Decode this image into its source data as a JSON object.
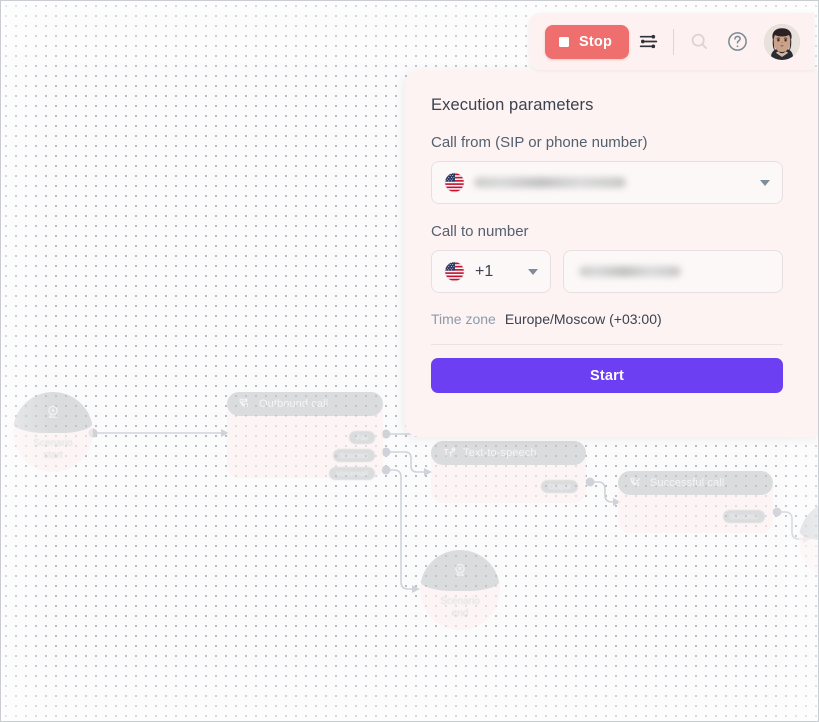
{
  "toolbar": {
    "stop_label": "Stop",
    "stop_icon": "stop-square-icon",
    "settings_icon": "sliders-icon",
    "search_icon": "search-icon",
    "help_icon": "question-circle-icon",
    "avatar_icon": "user-avatar",
    "accent_stop_color": "#ef6f6f"
  },
  "panel": {
    "title": "Execution parameters",
    "call_from": {
      "label": "Call from (SIP or phone number)",
      "flag_icon": "flag-us-icon",
      "value": "",
      "value_redacted": true,
      "caret_icon": "chevron-down-icon"
    },
    "call_to": {
      "label": "Call to number",
      "flag_icon": "flag-us-icon",
      "dial_code": "+1",
      "caret_icon": "chevron-down-icon",
      "number_value": "",
      "number_redacted": true,
      "number_placeholder": ""
    },
    "timezone": {
      "label": "Time zone",
      "value": "Europe/Moscow (+03:00)"
    },
    "start_label": "Start",
    "start_color": "#6d3ff2",
    "background_color": "#fdf3f3"
  },
  "canvas": {
    "background_color": "#fbfbfc",
    "grid": "dots",
    "nodes": [
      {
        "id": "scenario-start",
        "type": "round",
        "label": "Scenario\nstart",
        "label_line1": "Scenario",
        "label_line2": "start",
        "icon": "scenario-start-icon"
      },
      {
        "id": "outbound-call",
        "type": "block",
        "title": "Outbound call",
        "icon": "phone-outgoing-icon",
        "ports": [
          "Fail",
          "Success",
          "Voicemail"
        ]
      },
      {
        "id": "text-to-speech",
        "type": "block",
        "title": "Text-to-speech",
        "icon": "text-to-speech-icon",
        "ports": [
          "Output"
        ]
      },
      {
        "id": "successful-call",
        "type": "block",
        "title": "Successful call",
        "icon": "phone-check-icon",
        "ports": [
          "Success"
        ]
      },
      {
        "id": "scenario-end",
        "type": "round",
        "label_line1": "Scenario",
        "label_line2": "end",
        "icon": "scenario-end-icon"
      },
      {
        "id": "scenario-end-2",
        "type": "round",
        "label_line1": "",
        "label_line2": "",
        "icon": "scenario-end-icon"
      }
    ]
  }
}
